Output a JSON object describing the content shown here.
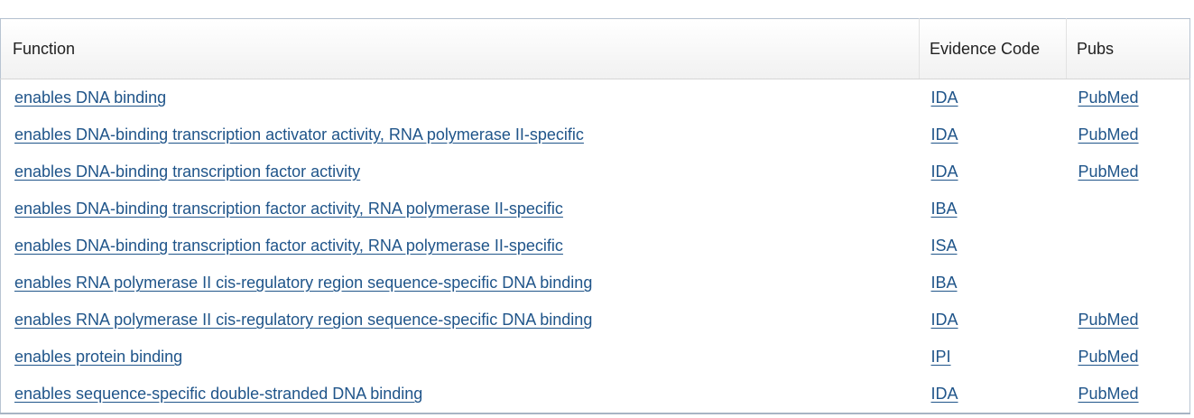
{
  "table": {
    "headers": {
      "function": "Function",
      "evidence_code": "Evidence Code",
      "pubs": "Pubs"
    },
    "rows": [
      {
        "function": "enables DNA binding",
        "code": "IDA",
        "pubs": "PubMed"
      },
      {
        "function": "enables DNA-binding transcription activator activity, RNA polymerase II-specific",
        "code": "IDA",
        "pubs": "PubMed"
      },
      {
        "function": "enables DNA-binding transcription factor activity",
        "code": "IDA",
        "pubs": "PubMed"
      },
      {
        "function": "enables DNA-binding transcription factor activity, RNA polymerase II-specific",
        "code": "IBA",
        "pubs": ""
      },
      {
        "function": "enables DNA-binding transcription factor activity, RNA polymerase II-specific",
        "code": "ISA",
        "pubs": ""
      },
      {
        "function": "enables RNA polymerase II cis-regulatory region sequence-specific DNA binding",
        "code": "IBA",
        "pubs": ""
      },
      {
        "function": "enables RNA polymerase II cis-regulatory region sequence-specific DNA binding",
        "code": "IDA",
        "pubs": "PubMed"
      },
      {
        "function": "enables protein binding",
        "code": "IPI",
        "pubs": "PubMed"
      },
      {
        "function": "enables sequence-specific double-stranded DNA binding",
        "code": "IDA",
        "pubs": "PubMed"
      }
    ]
  },
  "colors": {
    "link": "#20558a",
    "text": "#212121",
    "table_border": "#b8c4d2"
  }
}
